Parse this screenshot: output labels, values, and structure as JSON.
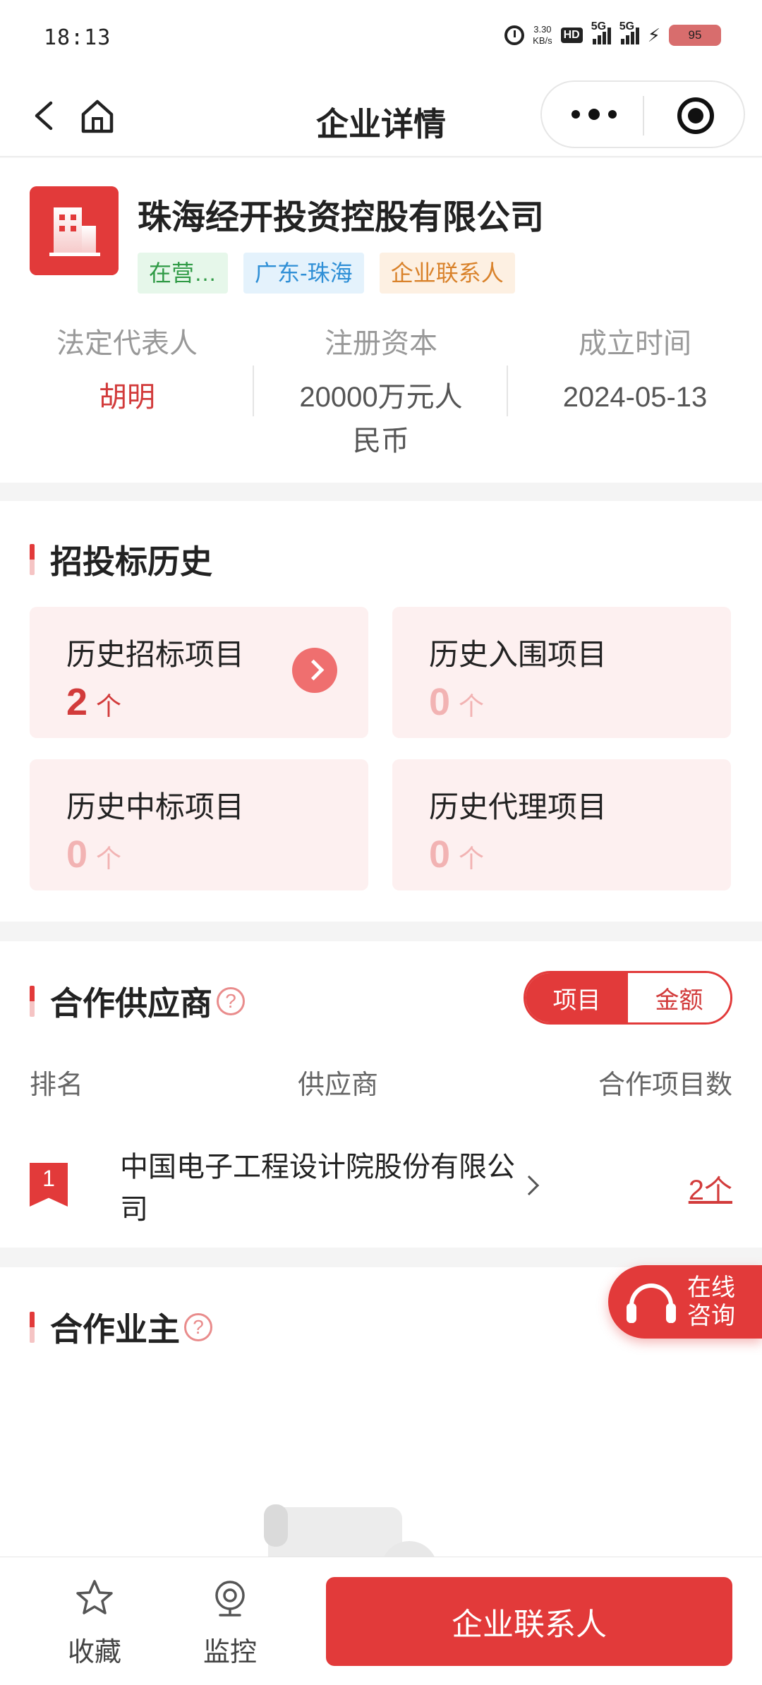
{
  "status_bar": {
    "time": "18:13",
    "net_speed_value": "3.30",
    "net_speed_unit": "KB/s",
    "hd_label": "HD",
    "signal_1": "5G",
    "signal_2": "5G",
    "battery": "95"
  },
  "navbar": {
    "title": "企业详情"
  },
  "company": {
    "name": "珠海经开投资控股有限公司",
    "tags": [
      "在营…",
      "广东-珠海",
      "企业联系人"
    ],
    "info": [
      {
        "label": "法定代表人",
        "value": "胡明"
      },
      {
        "label": "注册资本",
        "value": "20000万元人民币"
      },
      {
        "label": "成立时间",
        "value": "2024-05-13"
      }
    ]
  },
  "bid_history": {
    "title": "招投标历史",
    "unit": "个",
    "cards": [
      {
        "label": "历史招标项目",
        "count": "2"
      },
      {
        "label": "历史入围项目",
        "count": "0"
      },
      {
        "label": "历史中标项目",
        "count": "0"
      },
      {
        "label": "历史代理项目",
        "count": "0"
      }
    ]
  },
  "suppliers": {
    "title": "合作供应商",
    "help": "?",
    "toggle": [
      "项目",
      "金额"
    ],
    "columns": [
      "排名",
      "供应商",
      "合作项目数"
    ],
    "rows": [
      {
        "rank": "1",
        "name": "中国电子工程设计院股份有限公司",
        "count": "2个"
      }
    ]
  },
  "owners": {
    "title": "合作业主",
    "help": "?"
  },
  "consult": {
    "label": "在线咨询"
  },
  "bottom_bar": {
    "favorite": "收藏",
    "monitor": "监控",
    "contact": "企业联系人"
  },
  "colors": {
    "accent": "#e23a3a",
    "tag_green": "#2f9a45",
    "tag_blue": "#2f8fd6",
    "tag_orange": "#d9822b"
  }
}
